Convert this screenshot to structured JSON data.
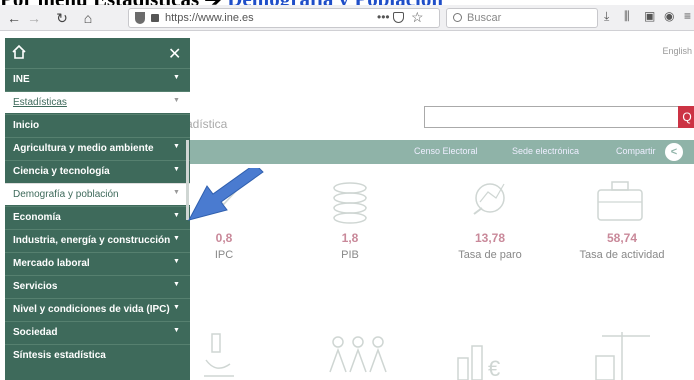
{
  "slide": {
    "title_left": "Por menú ",
    "title_mid": "Estadísticas ",
    "title_arrow": "➔ ",
    "title_highlight": "Demografía y Población"
  },
  "browser": {
    "url": "https://www.ine.es",
    "search_placeholder": "Buscar",
    "more_dots": "•••"
  },
  "site": {
    "language": "English",
    "subtitle": "adística",
    "navbar": {
      "censo": "Censo Electoral",
      "sede": "Sede electrónica",
      "compartir": "Compartir"
    },
    "stats": [
      {
        "value": "0,8",
        "label": "IPC"
      },
      {
        "value": "1,8",
        "label": "PIB"
      },
      {
        "value": "13,78",
        "label": "Tasa de paro"
      },
      {
        "value": "58,74",
        "label": "Tasa de actividad"
      }
    ]
  },
  "sidebar": {
    "items": [
      {
        "label": "INE",
        "style": "dark"
      },
      {
        "label": "Estadísticas",
        "style": "sub"
      },
      {
        "label": "Inicio",
        "style": "dark"
      },
      {
        "label": "Agricultura y medio ambiente",
        "style": "dark"
      },
      {
        "label": "Ciencia y tecnología",
        "style": "dark"
      },
      {
        "label": "Demografía y población",
        "style": "light"
      },
      {
        "label": "Economía",
        "style": "dark"
      },
      {
        "label": "Industria, energía y construcción",
        "style": "dark"
      },
      {
        "label": "Mercado laboral",
        "style": "dark"
      },
      {
        "label": "Servicios",
        "style": "dark"
      },
      {
        "label": "Nivel y condiciones de vida (IPC)",
        "style": "dark"
      },
      {
        "label": "Sociedad",
        "style": "dark"
      },
      {
        "label": "Síntesis estadística",
        "style": "dark"
      }
    ]
  },
  "colors": {
    "sidebar_bg": "#3e6a5b",
    "navbar_bg": "#8fb3a8",
    "stat_value": "#c9899a",
    "arrow": "#4a7bd0",
    "title_highlight": "#1f4ec8"
  }
}
